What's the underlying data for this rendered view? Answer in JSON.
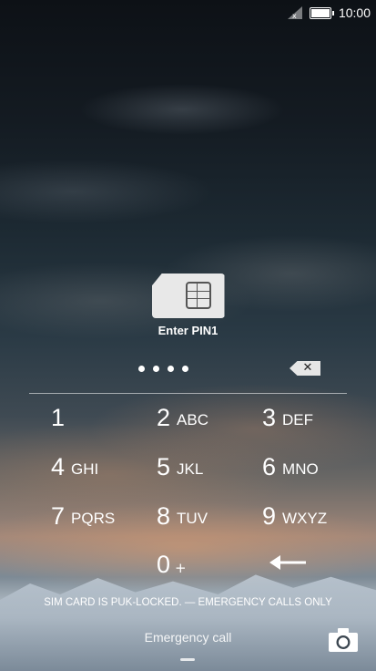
{
  "status_bar": {
    "time": "10:00",
    "signal_icon": "signal-no-sim-icon",
    "battery_icon": "battery-icon"
  },
  "sim": {
    "icon": "sim-card-icon",
    "prompt": "Enter PIN1"
  },
  "pin": {
    "entered_dots": 4,
    "backspace_icon": "backspace-icon",
    "backspace_glyph": "✕"
  },
  "keypad": {
    "k1": {
      "digit": "1",
      "letters": ""
    },
    "k2": {
      "digit": "2",
      "letters": "ABC"
    },
    "k3": {
      "digit": "3",
      "letters": "DEF"
    },
    "k4": {
      "digit": "4",
      "letters": "GHI"
    },
    "k5": {
      "digit": "5",
      "letters": "JKL"
    },
    "k6": {
      "digit": "6",
      "letters": "MNO"
    },
    "k7": {
      "digit": "7",
      "letters": "PQRS"
    },
    "k8": {
      "digit": "8",
      "letters": "TUV"
    },
    "k9": {
      "digit": "9",
      "letters": "WXYZ"
    },
    "k0": {
      "digit": "0",
      "letters": "+"
    },
    "enter_icon": "enter-arrow-icon"
  },
  "footer": {
    "sim_status": "SIM CARD IS PUK-LOCKED. — EMERGENCY CALLS ONLY",
    "emergency_label": "Emergency call",
    "camera_icon": "camera-icon"
  }
}
